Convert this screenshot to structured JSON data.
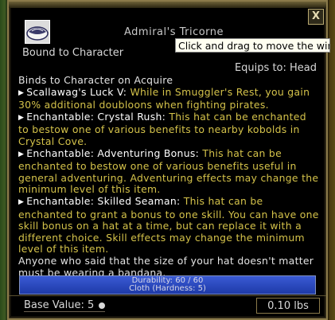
{
  "window": {
    "title": "Admiral's Tricorne",
    "close_label": "X",
    "bound_label": "Bound to Character",
    "equips_label": "Equips to: Head",
    "tooltip": "Click and drag to move the win"
  },
  "item": {
    "icon": "tricorne-hat-icon",
    "binds": "Binds to Character on Acquire",
    "effects": [
      {
        "name": "Scallawag's Luck V:",
        "text": "While in Smuggler's Rest, you gain 30% additional doubloons when fighting pirates."
      },
      {
        "name": "Enchantable: Crystal Rush:",
        "text": "This hat can be enchanted to bestow one of various benefits to nearby kobolds in Crystal Cove."
      },
      {
        "name": "Enchantable: Adventuring Bonus:",
        "text": "This hat can be enchanted to bestow one of various benefits useful in general adventuring. Adventuring effects may change the minimum level of this item."
      },
      {
        "name": "Enchantable: Skilled Seaman:",
        "text": "This hat can be enchanted to grant a bonus to one skill. You can have one skill bonus on a hat at a time, but can replace it with a different choice. Skill effects may change the minimum level of this item."
      }
    ],
    "flavor": "Anyone who said that the size of your hat doesn't matter must be wearing a bandana.",
    "durability": "Durability: 60 / 60",
    "material": "Cloth (Hardness: 5)",
    "durability_fraction": 1.0,
    "base_value": "Base Value: 5",
    "weight": "0.10 lbs"
  },
  "colors": {
    "effect_text": "#d4c24a",
    "bar": "#2a48c0"
  }
}
